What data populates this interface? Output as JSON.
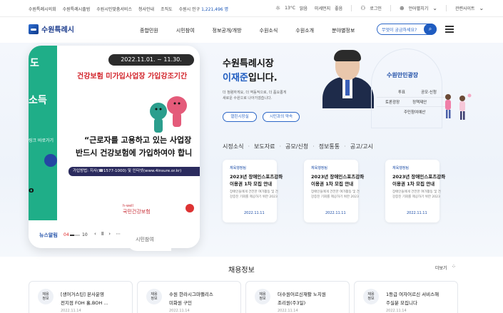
{
  "util": {
    "links": [
      "수원특례시의회",
      "수원특례시출범",
      "수원시민맞춤서비스",
      "청사안내",
      "조직도"
    ],
    "population_label": "수원시 인구",
    "population_value": "1,221,496 명",
    "temperature": "13°C",
    "weather": "맑음",
    "dust_label": "미세먼지",
    "dust_value": "좋음",
    "login": "로그인",
    "language": "언어펼치기",
    "related": "관련사이트"
  },
  "header": {
    "logo": "수원특례시",
    "nav": [
      "종합민원",
      "시민참여",
      "정보공개/개방",
      "수원소식",
      "수원소개",
      "분야별정보"
    ],
    "search_placeholder": "무엇이 궁금하세요?"
  },
  "banner": {
    "green_text_1": "도",
    "green_text_2": "소득",
    "green_text_3": "링크 바로가기",
    "dark_text": "o",
    "date_range": "2022.11.01. ~ 11.30.",
    "title": "건강보험 미가입사업장 가입강조기간",
    "quote_line_1": "“근로자를 고용하고 있는 사업장",
    "quote_line_2": "반드시 건강보험에 가입하여야 합니",
    "info": "가입방법: 지사(☎1577-1000) 및 인터넷(www.4insure.or.kr)",
    "nhis_name": "국민건강보험",
    "nhis_en": "h-well",
    "controls": {
      "label": "뉴스알림",
      "current": "04",
      "total": "10",
      "progress": 0.4
    },
    "citizen_tab": "시민참여"
  },
  "mayor": {
    "line1": "수원특례시장",
    "name": "이재준",
    "line2_suffix": "입니다.",
    "desc1": "더 청렴하게요, 더 역동적으로, 더 품요롭게",
    "desc2": "새로운 수원으로 나아가겠습니다.",
    "btn_office": "열린시장실",
    "btn_pledge": "시민과의 약속"
  },
  "plaza": {
    "title": "수원만민광장",
    "items": [
      "투표",
      "공모·신청",
      "토론광장",
      "정책제안",
      "주민참여예산"
    ]
  },
  "news": {
    "tabs": [
      "시정소식",
      "보도자료",
      "공모/신청",
      "정보통통",
      "공고/고시"
    ],
    "cards": [
      {
        "category": "체육행정팀",
        "title1": "2023년 장애인스포츠강좌",
        "title2": "이용권 1차 모집 안내",
        "desc1": "장애인들에게 건전한 여가활동 및 건",
        "desc2": "강증진 기회를 제공하기 위한 2023",
        "date": "2022.11.11"
      },
      {
        "category": "체육행정팀",
        "title1": "2023년 장애인스포츠강좌",
        "title2": "이용권 1차 모집 안내",
        "desc1": "장애인들에게 건전한 여가활동 및 건",
        "desc2": "강증진 기회를 제공하기 위한 2023",
        "date": "2022.11.11"
      },
      {
        "category": "체육행정팀",
        "title1": "2023년 장애인스포츠강좌",
        "title2": "이용권 1차 모집 안내",
        "desc1": "장애인들에게 건전한 여가활동 및 건",
        "desc2": "강증진 기회를 제공하기 위한 2023",
        "date": "2022.11.11"
      }
    ]
  },
  "jobs": {
    "title": "채용정보",
    "more": "더보기",
    "cards": [
      {
        "tag1": "채용",
        "tag2": "정보",
        "title1": "[생어거스틴] 본사운영",
        "title2": "전지점 FOH 홀,BOH ...",
        "date": "2022.11.14"
      },
      {
        "tag1": "채용",
        "tag2": "정보",
        "title1": "수원 한라시그마팰리스",
        "title2": "미화원 구인",
        "date": "2022.11.14"
      },
      {
        "tag1": "채용",
        "tag2": "정보",
        "title1": "더수원어르신재활 노치원",
        "title2": "조리원(주3일)",
        "date": "2022.11.14"
      },
      {
        "tag1": "채용",
        "tag2": "정보",
        "title1": "1등급 여자어르신 서비스해",
        "title2": "주실분 모집니다",
        "date": "2022.11.14"
      }
    ]
  },
  "colors": {
    "brand": "#1f5cc0",
    "banner_green": "#1fae88",
    "banner_red": "#d2232a"
  }
}
